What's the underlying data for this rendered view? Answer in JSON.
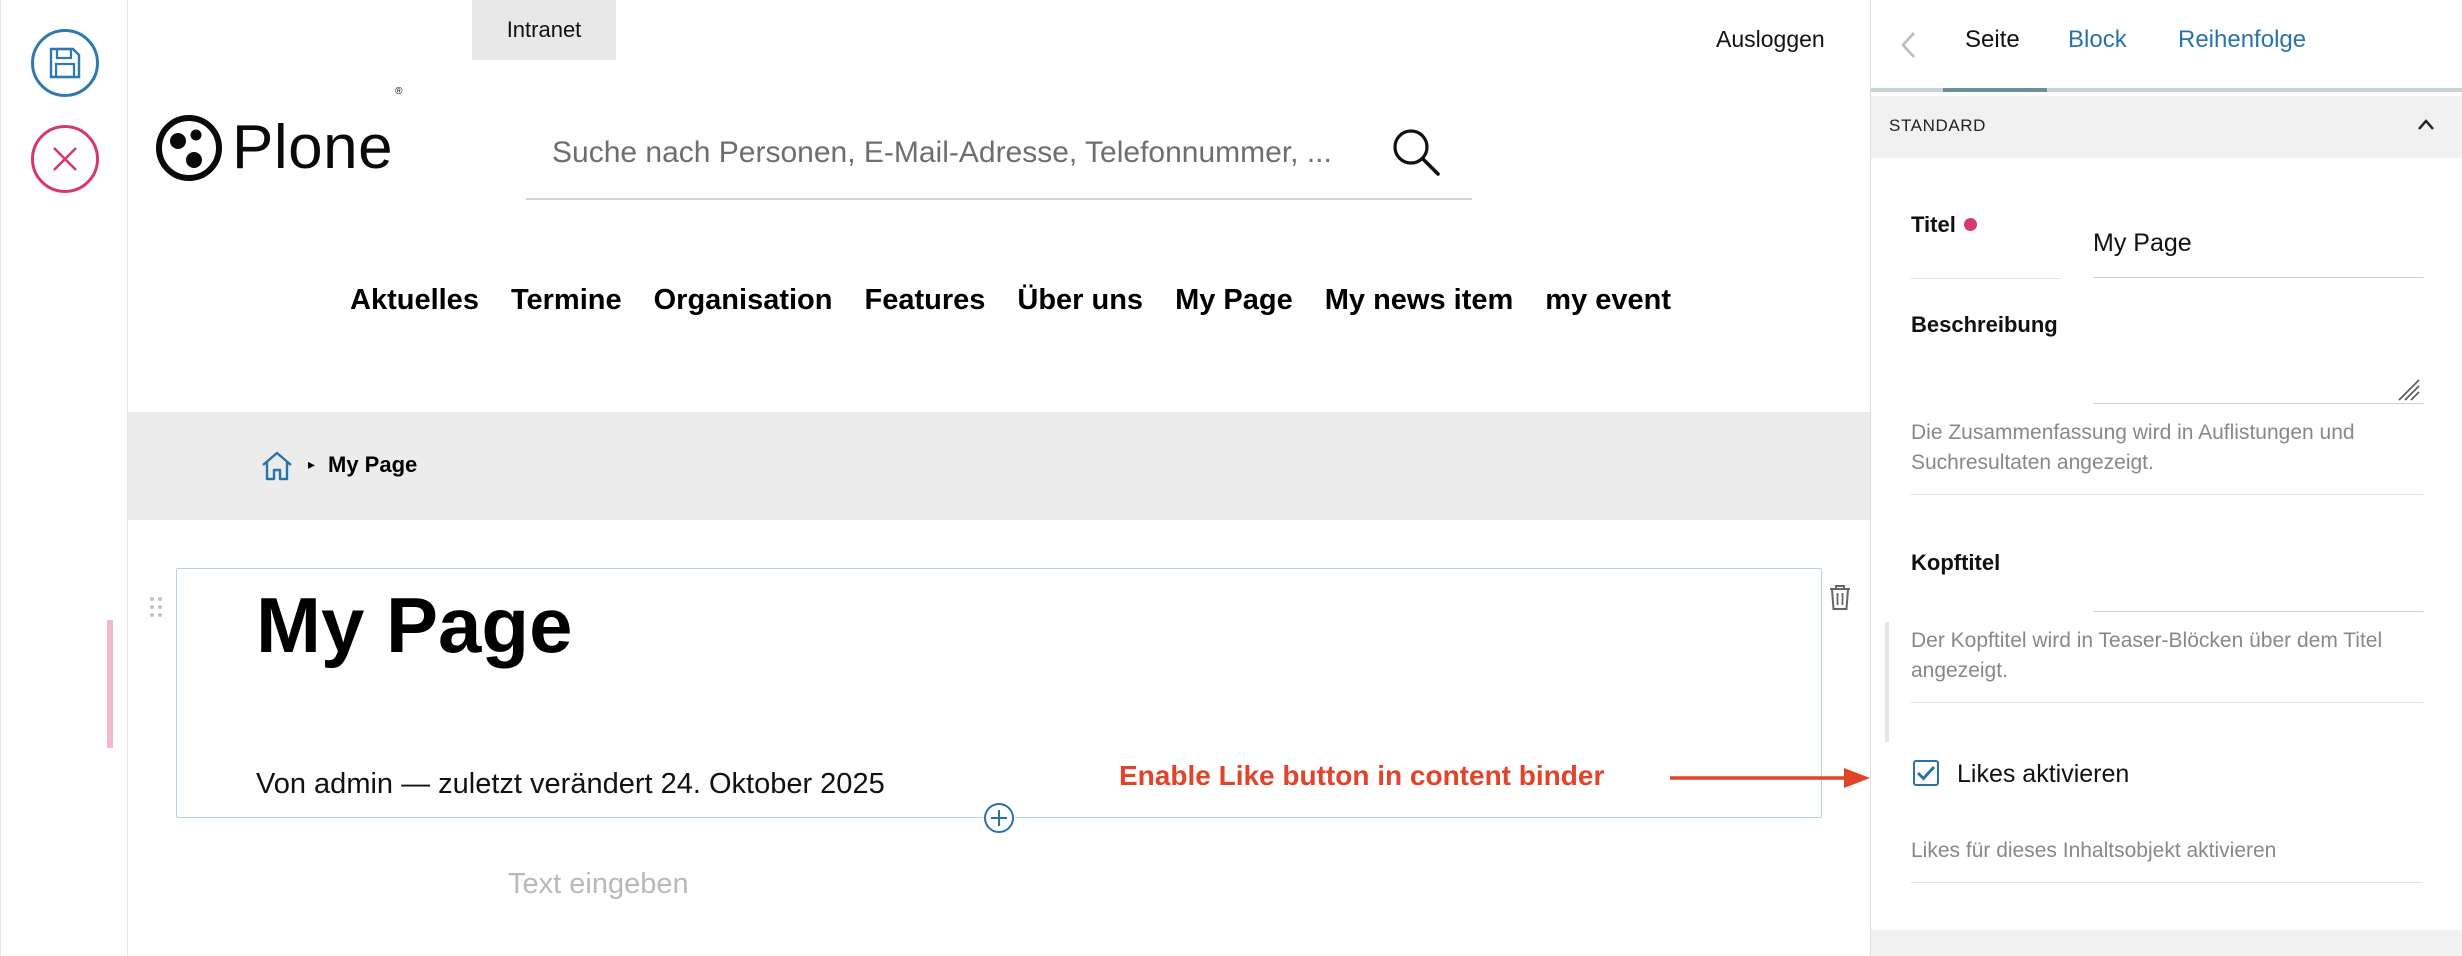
{
  "toolbar": {
    "save": "save-icon",
    "cancel": "close-icon"
  },
  "topbar": {
    "intranet_label": "Intranet",
    "logout_label": "Ausloggen"
  },
  "logo": {
    "text": "Plone",
    "reg": "®"
  },
  "search": {
    "placeholder": "Suche nach Personen, E-Mail-Adresse, Telefonnummer, ..."
  },
  "nav": {
    "items": [
      "Aktuelles",
      "Termine",
      "Organisation",
      "Features",
      "Über uns",
      "My Page",
      "My news item",
      "my event"
    ]
  },
  "breadcrumb": {
    "separator": "▸",
    "current": "My Page"
  },
  "content": {
    "title": "My Page",
    "byline": "Von admin — zuletzt verändert 24. Oktober 2025",
    "text_placeholder": "Text eingeben",
    "annotation": "Enable Like button in content binder"
  },
  "sidebar": {
    "tabs": [
      "Seite",
      "Block",
      "Reihenfolge"
    ],
    "active_tab": "Seite",
    "section_label": "STANDARD",
    "fields": {
      "title_label": "Titel",
      "title_value": "My Page",
      "description_label": "Beschreibung",
      "description_value": "",
      "description_help": "Die Zusammenfassung wird in Auflistungen und Suchresultaten angezeigt.",
      "headtitle_label": "Kopftitel",
      "headtitle_value": "",
      "headtitle_help": "Der Kopftitel wird in Teaser-Blöcken über dem Titel angezeigt.",
      "likes_label": "Likes aktivieren",
      "likes_checked": true,
      "likes_help": "Likes für dieses Inhaltsobjekt aktivieren"
    }
  },
  "colors": {
    "accent_blue": "#2a73a9",
    "required_pink": "#d63a67",
    "annotation_red": "#e0442a",
    "save_blue": "#2c7aaf",
    "cancel_pink": "#d43968"
  }
}
